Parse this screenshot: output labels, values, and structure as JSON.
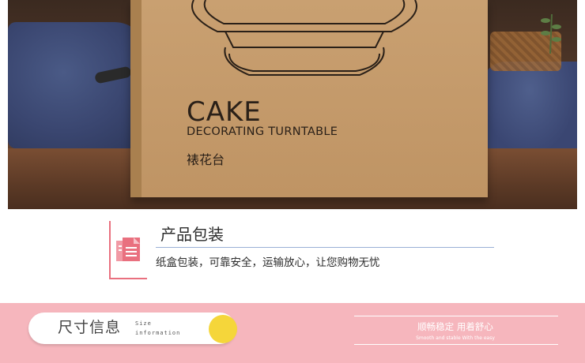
{
  "photo": {
    "box_title": "CAKE",
    "box_subtitle": "DECORATING TURNTABLE",
    "box_chinese": "裱花台"
  },
  "packaging": {
    "title": "产品包装",
    "description": "纸盒包装，可靠安全，运输放心，让您购物无忧",
    "icon": "document-icon",
    "accent_color": "#e9707f"
  },
  "banner": {
    "background": "#f6b6bd",
    "size_label_cn": "尺寸信息",
    "size_label_en_1": "Size",
    "size_label_en_2": "information",
    "dot_color": "#f5d63a",
    "slogan_cn": "顺畅稳定  用着舒心",
    "slogan_en": "Smooth and stable With the easy"
  }
}
